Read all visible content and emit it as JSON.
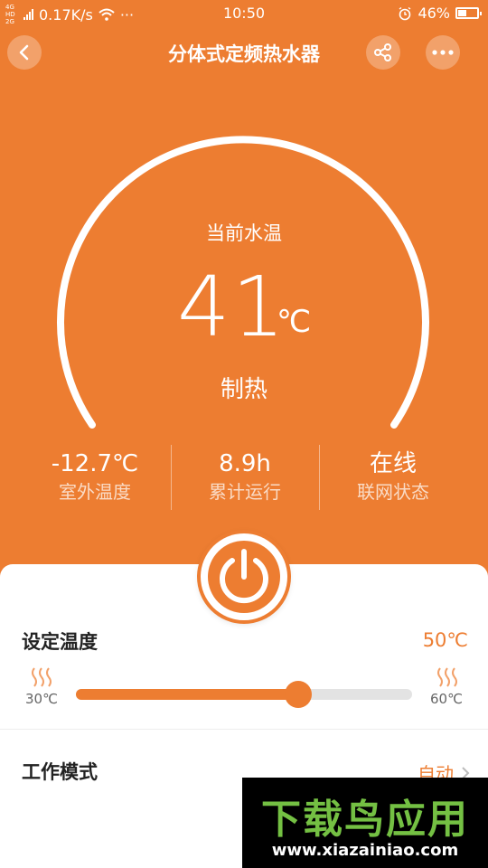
{
  "status_bar": {
    "signal_label": "4G HD 2G",
    "speed": "0.17K/s",
    "dots": "···",
    "time": "10:50",
    "battery": "46%"
  },
  "header": {
    "title": "分体式定频热水器"
  },
  "gauge": {
    "caption": "当前水温",
    "temperature": "41",
    "unit": "℃",
    "mode": "制热",
    "level_fraction": 0.41
  },
  "stats": [
    {
      "value": "-12.7℃",
      "label": "室外温度"
    },
    {
      "value": "8.9h",
      "label": "累计运行"
    },
    {
      "value": "在线",
      "label": "联网状态"
    }
  ],
  "settings": {
    "set_label": "设定温度",
    "set_value": "50℃",
    "min_label": "30℃",
    "max_label": "60℃",
    "min_value": 30,
    "max_value": 60,
    "current_value": 50,
    "slider_fraction": 0.66
  },
  "mode": {
    "label": "工作模式",
    "value": "自动"
  },
  "watermark": {
    "main": "下载鸟应用",
    "url": "www.xiazainiao.com"
  },
  "colors": {
    "accent": "#ED7D31",
    "track": "#e3e3e3",
    "watermark_green": "#74C043"
  }
}
